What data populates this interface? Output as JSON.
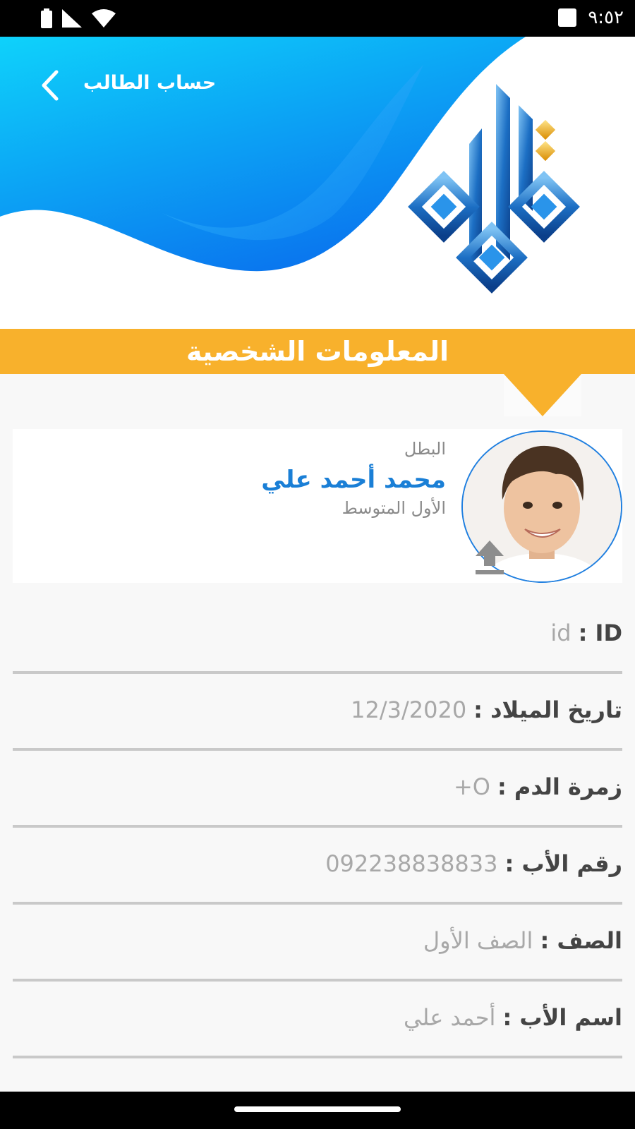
{
  "status_bar": {
    "time": "٩:٥٢",
    "icons": [
      "battery-icon",
      "signal-icon",
      "wifi-icon",
      "notification-icon"
    ]
  },
  "header": {
    "title": "حساب الطالب",
    "back_icon": "chevron-left-icon",
    "logo_name": "calligraphy-logo"
  },
  "section": {
    "title": "المعلومات الشخصية"
  },
  "profile": {
    "label": "البطل",
    "name": "محمد أحمد علي",
    "grade": "الأول المتوسط",
    "upload_icon": "upload-icon"
  },
  "fields": [
    {
      "label": "ID :",
      "value": "id"
    },
    {
      "label": "تاريخ الميلاد :",
      "value": "12/3/2020"
    },
    {
      "label": "زمرة الدم :",
      "value": "O+"
    },
    {
      "label": "رقم الأب :",
      "value": "092238838833"
    },
    {
      "label": "الصف :",
      "value": "الصف الأول"
    },
    {
      "label": "اسم الأب :",
      "value": "أحمد علي"
    }
  ],
  "colors": {
    "accent_blue": "#1a7fd6",
    "banner_orange": "#f8b12c",
    "wave_light": "#0ed2fb",
    "wave_dark": "#0a73ee"
  }
}
